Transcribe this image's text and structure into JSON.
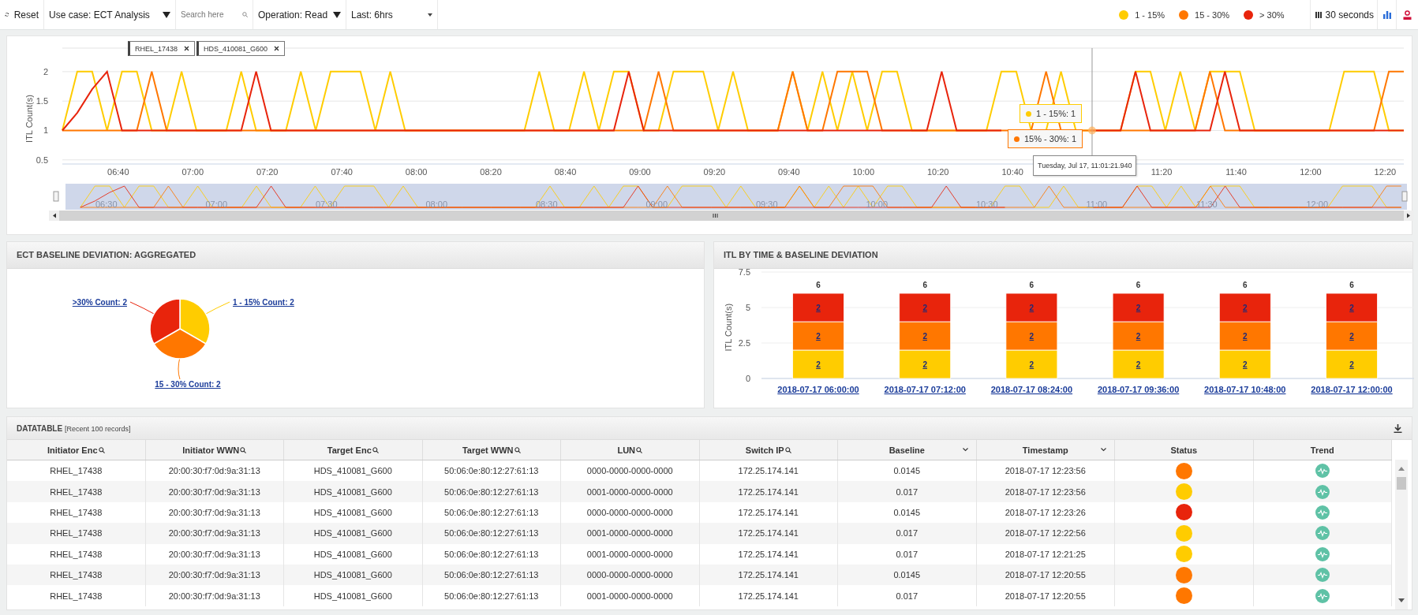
{
  "toolbar": {
    "reset": "Reset",
    "use_case": "Use case: ECT Analysis",
    "search": {
      "placeholder": "Search here"
    },
    "operation": "Operation: Read",
    "range": "Last: 6hrs",
    "legend": [
      {
        "label": "1 - 15%",
        "color": "#ffcc00"
      },
      {
        "label": "15 - 30%",
        "color": "#ff7700"
      },
      {
        "label": "> 30%",
        "color": "#e8240c"
      }
    ],
    "refresh": "30 seconds"
  },
  "timeline": {
    "filters": [
      "RHEL_17438",
      "HDS_410081_G600"
    ],
    "chart_data": {
      "type": "line",
      "ylabel": "ITL Count(s)",
      "grid": true,
      "xlim": [
        385,
        745
      ],
      "ylim": [
        0.43,
        2.4
      ],
      "ref_lines": [
        {
          "axis": "x",
          "value": 661.35
        }
      ],
      "yticks": [
        0.5,
        1,
        1.5,
        2
      ],
      "xticks": [
        {
          "value": 400,
          "label": "06:40"
        },
        {
          "value": 420,
          "label": "07:00"
        },
        {
          "value": 440,
          "label": "07:20"
        },
        {
          "value": 460,
          "label": "07:40"
        },
        {
          "value": 480,
          "label": "08:00"
        },
        {
          "value": 500,
          "label": "08:20"
        },
        {
          "value": 520,
          "label": "08:40"
        },
        {
          "value": 540,
          "label": "09:00"
        },
        {
          "value": 560,
          "label": "09:20"
        },
        {
          "value": 580,
          "label": "09:40"
        },
        {
          "value": 600,
          "label": "10:00"
        },
        {
          "value": 620,
          "label": "10:20"
        },
        {
          "value": 640,
          "label": "10:40"
        },
        {
          "value": 680,
          "label": "11:20"
        },
        {
          "value": 700,
          "label": "11:40"
        },
        {
          "value": 720,
          "label": "12:00"
        },
        {
          "value": 740,
          "label": "12:20"
        }
      ],
      "x": [
        385,
        389,
        393,
        397,
        401,
        405,
        409,
        413,
        417,
        421,
        425,
        429,
        433,
        437,
        441,
        445,
        449,
        453,
        457,
        461,
        465,
        469,
        473,
        477,
        481,
        485,
        489,
        493,
        497,
        501,
        505,
        509,
        513,
        517,
        521,
        525,
        529,
        533,
        537,
        541,
        545,
        549,
        553,
        557,
        561,
        565,
        569,
        573,
        577,
        581,
        585,
        589,
        593,
        597,
        601,
        605,
        609,
        613,
        617,
        621,
        625,
        629,
        633,
        637,
        641,
        645,
        649,
        653,
        657,
        661,
        665,
        669,
        673,
        677,
        681,
        685,
        689,
        693,
        697,
        701,
        705,
        709,
        713,
        717,
        721,
        725,
        729,
        733,
        737,
        741,
        745
      ],
      "series": [
        {
          "color": "#ffcc00",
          "values": [
            1,
            2,
            2,
            1,
            2,
            2,
            1,
            1,
            2,
            1,
            1,
            1,
            2,
            1,
            1,
            1,
            2,
            1,
            2,
            2,
            2,
            1,
            2,
            1,
            1,
            1,
            1,
            1,
            1,
            1,
            1,
            1,
            2,
            1,
            1,
            2,
            1,
            2,
            2,
            1,
            1,
            2,
            2,
            2,
            1,
            2,
            1,
            1,
            1,
            2,
            1,
            2,
            1,
            2,
            1,
            2,
            2,
            1,
            1,
            1,
            1,
            1,
            1,
            2,
            2,
            1,
            1,
            2,
            1,
            1,
            1,
            1,
            2,
            2,
            1,
            2,
            1,
            2,
            2,
            2,
            1,
            1,
            1,
            1,
            1,
            1,
            2,
            2,
            2,
            1,
            1
          ]
        },
        {
          "color": "#ff7700",
          "values": [
            1,
            1,
            1,
            1,
            1,
            1,
            2,
            1,
            1,
            1,
            1,
            1,
            1,
            1,
            1,
            1,
            1,
            1,
            1,
            1,
            1,
            1,
            1,
            1,
            1,
            1,
            1,
            1,
            1,
            1,
            1,
            1,
            1,
            1,
            1,
            1,
            1,
            1,
            1,
            1,
            2,
            1,
            1,
            1,
            1,
            1,
            1,
            1,
            1,
            2,
            1,
            1,
            2,
            2,
            2,
            1,
            1,
            1,
            1,
            1,
            1,
            1,
            1,
            1,
            1,
            1,
            2,
            1,
            1,
            1,
            1,
            1,
            1,
            1,
            1,
            1,
            1,
            2,
            1,
            1,
            1,
            1,
            1,
            1,
            1,
            1,
            1,
            1,
            1,
            2,
            2
          ]
        },
        {
          "color": "#e8240c",
          "values": [
            1,
            1.3,
            1.7,
            2,
            1,
            1,
            1,
            1,
            1,
            1,
            1,
            1,
            1,
            2,
            1,
            1,
            1,
            1,
            1,
            1,
            1,
            1,
            1,
            1,
            1,
            1,
            1,
            1,
            1,
            1,
            1,
            1,
            1,
            1,
            1,
            1,
            1,
            1,
            2,
            1,
            1,
            1,
            1,
            1,
            1,
            1,
            1,
            1,
            1,
            1,
            1,
            1,
            1,
            1,
            1,
            1,
            1,
            1,
            1,
            2,
            1,
            1,
            1,
            1,
            null,
            null,
            null,
            null,
            null,
            1,
            1,
            1,
            2,
            1,
            1,
            1,
            1,
            1,
            2,
            1,
            1,
            1,
            1,
            1,
            1,
            1,
            1,
            1,
            1,
            1,
            1
          ]
        }
      ]
    },
    "tooltip": {
      "items": [
        {
          "label": "1 - 15%: 1",
          "color": "#ffcc00"
        },
        {
          "label": "15% - 30%: 1",
          "color": "#ff7700"
        }
      ],
      "time": "Tuesday, Jul 17, 11:01:21.940"
    },
    "navigator": {
      "labels": [
        "06:30",
        "07:00",
        "07:30",
        "08:00",
        "08:30",
        "09:00",
        "09:30",
        "10:00",
        "10:30",
        "11:00",
        "11:30",
        "12:00"
      ]
    }
  },
  "deviation_panel": {
    "title": "ECT BASELINE DEVIATION: AGGREGATED",
    "chart_data": {
      "type": "pie",
      "categories": [
        "1 - 15% Count: 2",
        "15 - 30% Count: 2",
        ">30% Count: 2"
      ],
      "values": [
        2,
        2,
        2
      ]
    }
  },
  "itl_panel": {
    "title": "ITL BY TIME & BASELINE DEVIATION",
    "chart_data": {
      "type": "bar",
      "ylabel": "ITL Count(s)",
      "stacked": true,
      "ylim": [
        0,
        7.5
      ],
      "yticks": [
        0,
        2.5,
        5,
        7.5
      ],
      "data_labels": true,
      "categories": [
        "2018-07-17 06:00:00",
        "2018-07-17 07:12:00",
        "2018-07-17 08:24:00",
        "2018-07-17 09:36:00",
        "2018-07-17 10:48:00",
        "2018-07-17 12:00:00"
      ],
      "series": [
        {
          "color": "#ffcc00",
          "values": [
            2,
            2,
            2,
            2,
            2,
            2
          ]
        },
        {
          "color": "#ff7700",
          "values": [
            2,
            2,
            2,
            2,
            2,
            2
          ]
        },
        {
          "color": "#e8240c",
          "values": [
            2,
            2,
            2,
            2,
            2,
            2
          ]
        }
      ],
      "annotations": [
        "6",
        "6",
        "6",
        "6",
        "6",
        "6"
      ]
    }
  },
  "datatable": {
    "title": "DATATABLE",
    "subtitle": "[Recent 100 records]",
    "columns": [
      {
        "label": "Initiator Enc",
        "kind": "search"
      },
      {
        "label": "Initiator WWN",
        "kind": "search"
      },
      {
        "label": "Target Enc",
        "kind": "search"
      },
      {
        "label": "Target WWN",
        "kind": "search"
      },
      {
        "label": "LUN",
        "kind": "search"
      },
      {
        "label": "Switch IP",
        "kind": "search"
      },
      {
        "label": "Baseline",
        "kind": "sort"
      },
      {
        "label": "Timestamp",
        "kind": "sort"
      },
      {
        "label": "Status",
        "kind": "plain"
      },
      {
        "label": "Trend",
        "kind": "plain"
      }
    ],
    "rows": [
      {
        "cells": [
          "RHEL_17438",
          "20:00:30:f7:0d:9a:31:13",
          "HDS_410081_G600",
          "50:06:0e:80:12:27:61:13",
          "0000-0000-0000-0000",
          "172.25.174.141",
          "0.0145",
          "2018-07-17 12:23:56"
        ],
        "color": "#ff7700"
      },
      {
        "cells": [
          "RHEL_17438",
          "20:00:30:f7:0d:9a:31:13",
          "HDS_410081_G600",
          "50:06:0e:80:12:27:61:13",
          "0001-0000-0000-0000",
          "172.25.174.141",
          "0.017",
          "2018-07-17 12:23:56"
        ],
        "color": "#ffcc00"
      },
      {
        "cells": [
          "RHEL_17438",
          "20:00:30:f7:0d:9a:31:13",
          "HDS_410081_G600",
          "50:06:0e:80:12:27:61:13",
          "0000-0000-0000-0000",
          "172.25.174.141",
          "0.0145",
          "2018-07-17 12:23:26"
        ],
        "color": "#e8240c"
      },
      {
        "cells": [
          "RHEL_17438",
          "20:00:30:f7:0d:9a:31:13",
          "HDS_410081_G600",
          "50:06:0e:80:12:27:61:13",
          "0001-0000-0000-0000",
          "172.25.174.141",
          "0.017",
          "2018-07-17 12:22:56"
        ],
        "color": "#ffcc00"
      },
      {
        "cells": [
          "RHEL_17438",
          "20:00:30:f7:0d:9a:31:13",
          "HDS_410081_G600",
          "50:06:0e:80:12:27:61:13",
          "0001-0000-0000-0000",
          "172.25.174.141",
          "0.017",
          "2018-07-17 12:21:25"
        ],
        "color": "#ffcc00"
      },
      {
        "cells": [
          "RHEL_17438",
          "20:00:30:f7:0d:9a:31:13",
          "HDS_410081_G600",
          "50:06:0e:80:12:27:61:13",
          "0000-0000-0000-0000",
          "172.25.174.141",
          "0.0145",
          "2018-07-17 12:20:55"
        ],
        "color": "#ff7700"
      },
      {
        "cells": [
          "RHEL_17438",
          "20:00:30:f7:0d:9a:31:13",
          "HDS_410081_G600",
          "50:06:0e:80:12:27:61:13",
          "0001-0000-0000-0000",
          "172.25.174.141",
          "0.017",
          "2018-07-17 12:20:55"
        ],
        "color": "#ff7700"
      }
    ]
  }
}
